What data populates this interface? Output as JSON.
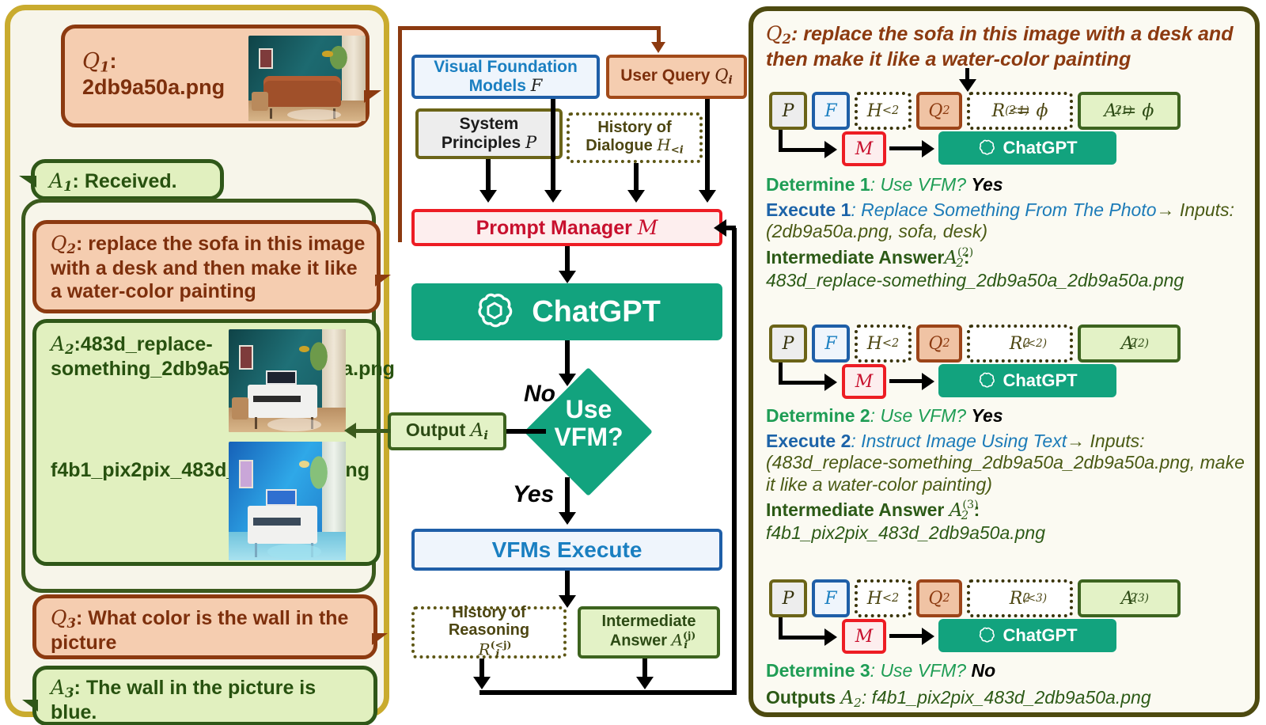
{
  "left_dialog": {
    "messages": [
      {
        "id": "q1",
        "role": "user",
        "label": "Q",
        "index": "1",
        "text": "2db9a50a.png",
        "has_image": true,
        "image": "living-room-with-brown-leather-sofa"
      },
      {
        "id": "a1",
        "role": "assistant",
        "label": "A",
        "index": "1",
        "text": "Received.",
        "has_image": false
      },
      {
        "id": "q2",
        "role": "user",
        "label": "Q",
        "index": "2",
        "text": "replace the sofa in this image with a desk and then make it like a water-color painting",
        "has_image": false
      },
      {
        "id": "a2",
        "role": "assistant",
        "label": "A",
        "index": "2",
        "text": "483d_replace-something_2db9a50a_2db9a50a.png",
        "text2": "f4b1_pix2pix_483d_2db9a50a.png",
        "has_image": true,
        "image": "living-room-with-white-desk",
        "image2": "living-room-watercolor-blue"
      },
      {
        "id": "q3",
        "role": "user",
        "label": "Q",
        "index": "3",
        "text": "What color is the wall in the picture",
        "has_image": false
      },
      {
        "id": "a3",
        "role": "assistant",
        "label": "A",
        "index": "3",
        "text": "The wall in the picture is blue.",
        "has_image": false
      }
    ]
  },
  "flow": {
    "nodes": {
      "vfm_models": {
        "line1": "Visual Foundation",
        "line2": "Models",
        "sym": "F"
      },
      "user_query": {
        "text": "User Query",
        "sym": "Q",
        "sub": "i"
      },
      "system_principles": {
        "line1": "System",
        "line2": "Principles",
        "sym": "P"
      },
      "history_dialogue": {
        "line1": "History of",
        "line2": "Dialogue",
        "sym": "H",
        "sub": "<i"
      },
      "prompt_manager": {
        "text": "Prompt  Manager",
        "sym": "M"
      },
      "chatgpt": {
        "text": "ChatGPT"
      },
      "decision": {
        "line1": "Use",
        "line2": "VFM?"
      },
      "output": {
        "text": "Output",
        "sym": "A",
        "sub": "i"
      },
      "vfms_execute": {
        "text": "VFMs Execute"
      },
      "history_reasoning": {
        "line1": "History of",
        "line2": "Reasoning",
        "sym": "R",
        "sub": "i",
        "sup": "(<j)"
      },
      "intermediate_answer": {
        "line1": "Intermediate",
        "line2": "Answer",
        "sym": "A",
        "sub": "i",
        "sup": "(j)"
      }
    },
    "edge_labels": {
      "no": "No",
      "yes": "Yes"
    }
  },
  "right_panel": {
    "query": "Q₂: replace the sofa in this image with a desk and then make it like a water-color painting",
    "query_prefix_sym": "Q",
    "query_prefix_sub": "2",
    "query_text": ": replace the sofa in this image with a desk and then make it like a water-color painting",
    "rounds": [
      {
        "chips": [
          {
            "k": "p",
            "sym": "P",
            "sub": "",
            "sup": "",
            "eq": ""
          },
          {
            "k": "f",
            "sym": "F",
            "sub": "",
            "sup": "",
            "eq": ""
          },
          {
            "k": "h",
            "sym": "H",
            "sub": "<2",
            "sup": "",
            "eq": ""
          },
          {
            "k": "q",
            "sym": "Q",
            "sub": "2",
            "sup": "",
            "eq": ""
          },
          {
            "k": "r",
            "sym": "R",
            "sub": "2",
            "sup": "(<1)",
            "eq": " = ϕ"
          },
          {
            "k": "a",
            "sym": "A",
            "sub": "2",
            "sup": "(1)",
            "eq": " = ϕ"
          }
        ],
        "manager_sym": "M",
        "gpt_label": "ChatGPT",
        "determine_label": "Determine 1",
        "determine_q": ": Use VFM? ",
        "determine_a": "Yes",
        "execute_label": "Execute 1",
        "execute_text": ": Replace Something From The Photo",
        "execute_arrow": "→",
        "execute_inputs": " Inputs: (2db9a50a.png, sofa, desk)",
        "inter_label": "Intermediate Answer",
        "inter_sym": "A",
        "inter_sub": "2",
        "inter_sup": "(2)",
        "inter_value": "483d_replace-something_2db9a50a_2db9a50a.png"
      },
      {
        "chips": [
          {
            "k": "p",
            "sym": "P",
            "sub": "",
            "sup": "",
            "eq": ""
          },
          {
            "k": "f",
            "sym": "F",
            "sub": "",
            "sup": "",
            "eq": ""
          },
          {
            "k": "h",
            "sym": "H",
            "sub": "<2",
            "sup": "",
            "eq": ""
          },
          {
            "k": "q",
            "sym": "Q",
            "sub": "2",
            "sup": "",
            "eq": ""
          },
          {
            "k": "r",
            "sym": "R",
            "sub": "2",
            "sup": "(<2)",
            "eq": ""
          },
          {
            "k": "a",
            "sym": "A",
            "sub": "2",
            "sup": "(2)",
            "eq": ""
          }
        ],
        "manager_sym": "M",
        "gpt_label": "ChatGPT",
        "determine_label": "Determine 2",
        "determine_q": ": Use VFM? ",
        "determine_a": "Yes",
        "execute_label": "Execute 2",
        "execute_text": ": Instruct Image Using Text",
        "execute_arrow": "→",
        "execute_inputs": " Inputs: (483d_replace-something_2db9a50a_2db9a50a.png, make it like a water-color painting)",
        "inter_label": "Intermediate Answer",
        "inter_sym": "A",
        "inter_sub": "2",
        "inter_sup": "(3)",
        "inter_value": "f4b1_pix2pix_483d_2db9a50a.png"
      },
      {
        "chips": [
          {
            "k": "p",
            "sym": "P",
            "sub": "",
            "sup": "",
            "eq": ""
          },
          {
            "k": "f",
            "sym": "F",
            "sub": "",
            "sup": "",
            "eq": ""
          },
          {
            "k": "h",
            "sym": "H",
            "sub": "<2",
            "sup": "",
            "eq": ""
          },
          {
            "k": "q",
            "sym": "Q",
            "sub": "2",
            "sup": "",
            "eq": ""
          },
          {
            "k": "r",
            "sym": "R",
            "sub": "2",
            "sup": "(<3)",
            "eq": ""
          },
          {
            "k": "a",
            "sym": "A",
            "sub": "2",
            "sup": "(3)",
            "eq": ""
          }
        ],
        "manager_sym": "M",
        "gpt_label": "ChatGPT",
        "determine_label": "Determine 3",
        "determine_q": ": Use VFM? ",
        "determine_a": "No",
        "outputs_label": "Outputs",
        "outputs_sym": "A",
        "outputs_sub": "2",
        "outputs_value": ": f4b1_pix2pix_483d_2db9a50a.png"
      }
    ]
  },
  "colors": {
    "panel_border_gold": "#c9ab2e",
    "panel_border_green": "#3b5a1d",
    "panel_border_olive": "#4d4a10",
    "user_bubble_bg": "#f5cdb0",
    "user_bubble_border": "#8c3a10",
    "assistant_bubble_bg": "#e1f0bf",
    "assistant_bubble_border": "#2f5718",
    "chatgpt_green": "#12a37e",
    "prompt_manager_red": "#ed1c24",
    "vfm_blue": "#1f5fa8",
    "determine_green": "#1f9d55"
  }
}
